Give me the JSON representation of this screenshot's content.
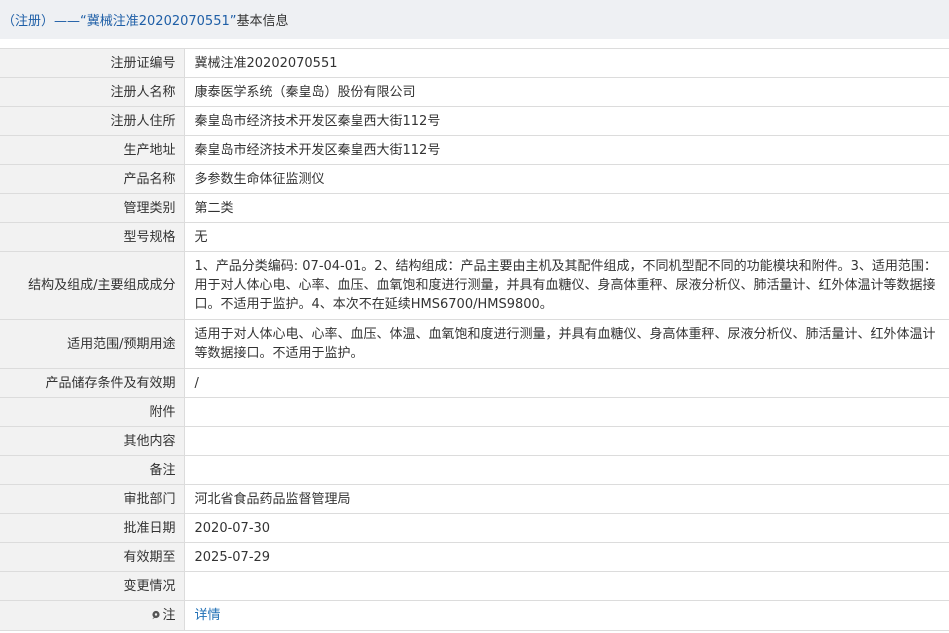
{
  "header": {
    "title_prefix": "（注册）——",
    "title_quoted": "“冀械注准20202070551”",
    "title_suffix": "基本信息"
  },
  "rows": [
    {
      "label": "注册证编号",
      "value": "冀械注准20202070551"
    },
    {
      "label": "注册人名称",
      "value": "康泰医学系统（秦皇岛）股份有限公司"
    },
    {
      "label": "注册人住所",
      "value": "秦皇岛市经济技术开发区秦皇西大街112号"
    },
    {
      "label": "生产地址",
      "value": "秦皇岛市经济技术开发区秦皇西大街112号"
    },
    {
      "label": "产品名称",
      "value": "多参数生命体征监测仪"
    },
    {
      "label": "管理类别",
      "value": "第二类"
    },
    {
      "label": "型号规格",
      "value": "无"
    },
    {
      "label": "结构及组成/主要组成成分",
      "value": "1、产品分类编码: 07-04-01。2、结构组成：产品主要由主机及其配件组成，不同机型配不同的功能模块和附件。3、适用范围：用于对人体心电、心率、血压、血氧饱和度进行测量，并具有血糖仪、身高体重秤、尿液分析仪、肺活量计、红外体温计等数据接口。不适用于监护。4、本次不在延续HMS6700/HMS9800。"
    },
    {
      "label": "适用范围/预期用途",
      "value": "适用于对人体心电、心率、血压、体温、血氧饱和度进行测量，并具有血糖仪、身高体重秤、尿液分析仪、肺活量计、红外体温计等数据接口。不适用于监护。"
    },
    {
      "label": "产品储存条件及有效期",
      "value": "/"
    },
    {
      "label": "附件",
      "value": ""
    },
    {
      "label": "其他内容",
      "value": ""
    },
    {
      "label": "备注",
      "value": ""
    },
    {
      "label": "审批部门",
      "value": "河北省食品药品监督管理局"
    },
    {
      "label": "批准日期",
      "value": "2020-07-30"
    },
    {
      "label": "有效期至",
      "value": "2025-07-29"
    },
    {
      "label": "变更情况",
      "value": ""
    }
  ],
  "note_row": {
    "label": "注",
    "icon": "info-pin-icon",
    "link_text": "详情"
  },
  "colors": {
    "header_bg": "#eef0f3",
    "header_text": "#1f5fa7",
    "label_bg": "#f2f2f2",
    "border": "#dcdcdc",
    "link": "#1f6fb5"
  }
}
